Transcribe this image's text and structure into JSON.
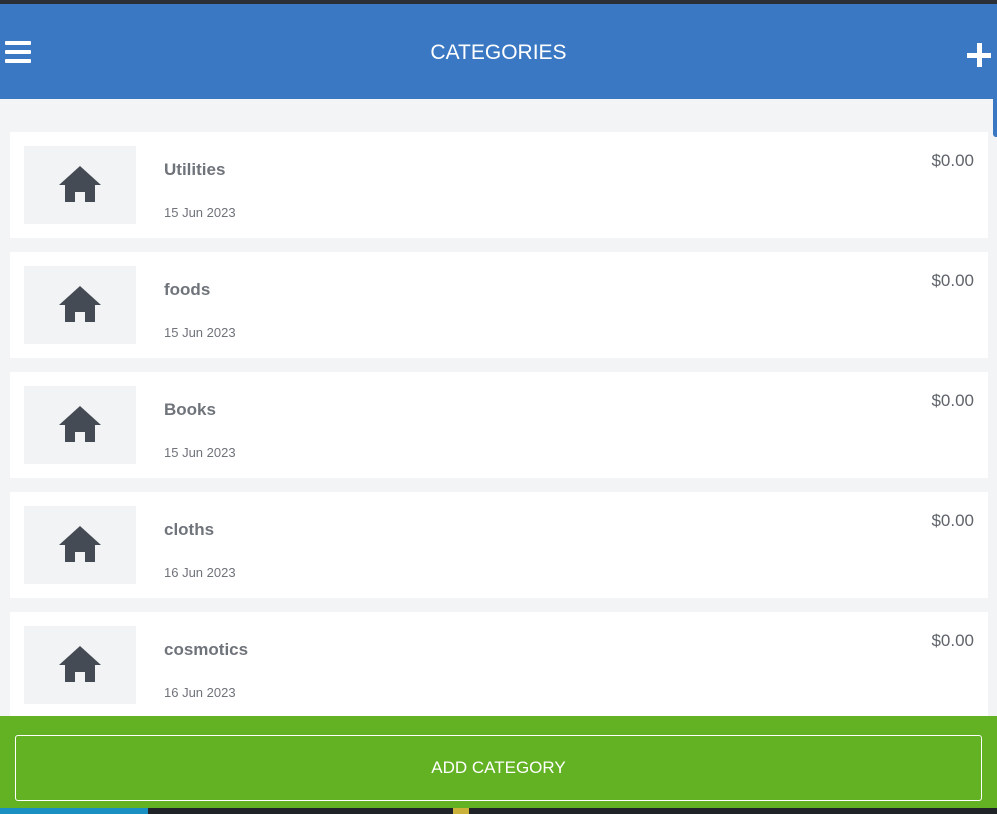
{
  "header": {
    "title": "CATEGORIES",
    "menu_icon": "hamburger-menu-icon",
    "add_icon": "plus-icon",
    "color": "#3a78c3"
  },
  "categories": [
    {
      "name": "Utilities",
      "date": "15 Jun 2023",
      "amount": "$0.00",
      "icon": "home-icon"
    },
    {
      "name": "foods",
      "date": "15 Jun 2023",
      "amount": "$0.00",
      "icon": "home-icon"
    },
    {
      "name": "Books",
      "date": "15 Jun 2023",
      "amount": "$0.00",
      "icon": "home-icon"
    },
    {
      "name": "cloths",
      "date": "16 Jun 2023",
      "amount": "$0.00",
      "icon": "home-icon"
    },
    {
      "name": "cosmotics",
      "date": "16 Jun 2023",
      "amount": "$0.00",
      "icon": "home-icon"
    }
  ],
  "footer": {
    "add_label": "ADD CATEGORY",
    "color": "#62b224"
  }
}
